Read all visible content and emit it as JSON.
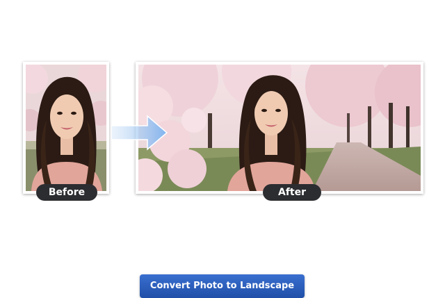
{
  "comparison": {
    "before_label": "Before",
    "after_label": "After"
  },
  "action": {
    "convert_label": "Convert Photo to Landscape"
  },
  "icons": {
    "transition": "right-arrow-icon"
  },
  "colors": {
    "label_bg": "#2c2d31",
    "button_bg": "#2a5cc0",
    "arrow": "#7fb4ef"
  }
}
